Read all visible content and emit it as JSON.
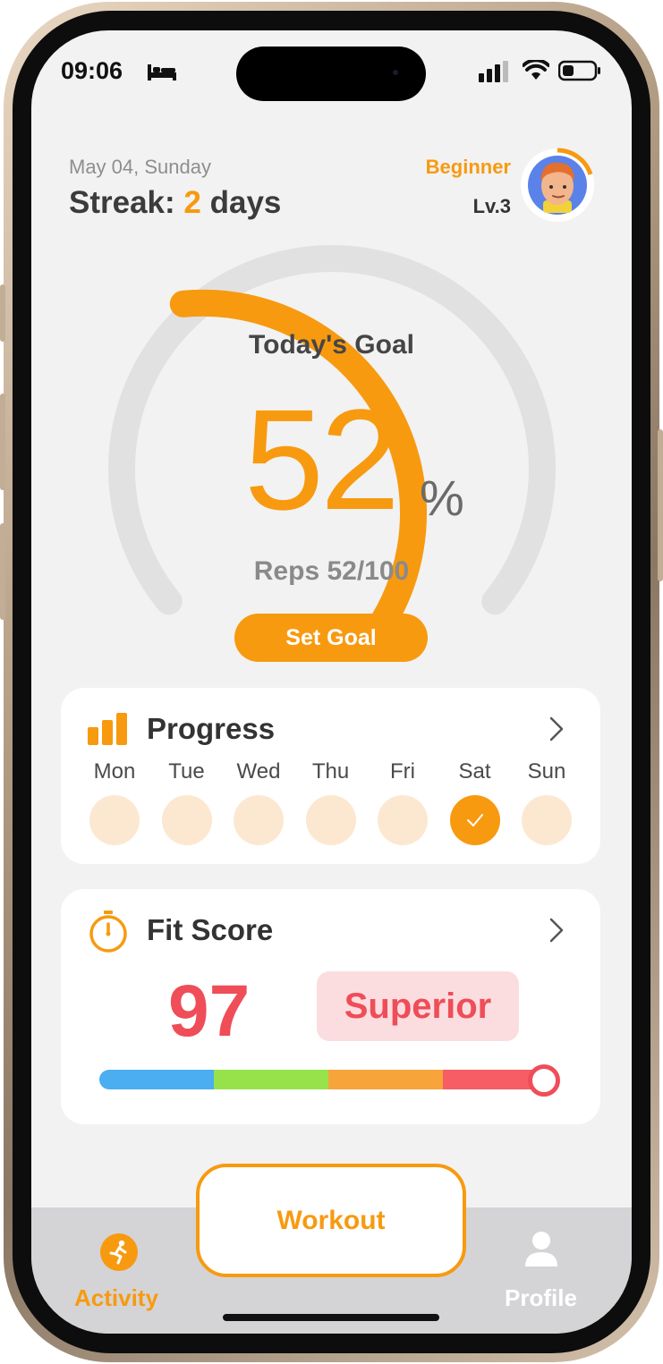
{
  "status_bar": {
    "time": "09:06"
  },
  "header": {
    "date": "May 04, Sunday",
    "streak_prefix": "Streak: ",
    "streak_count": "2",
    "streak_suffix": " days",
    "level_name": "Beginner",
    "level_number": "Lv.3"
  },
  "goal": {
    "label": "Today's Goal",
    "value": "52",
    "unit": "%",
    "progress_fraction": 0.52,
    "reps_text": "Reps 52/100",
    "set_goal_label": "Set Goal"
  },
  "progress_card": {
    "title": "Progress",
    "days": [
      {
        "label": "Mon",
        "done": false
      },
      {
        "label": "Tue",
        "done": false
      },
      {
        "label": "Wed",
        "done": false
      },
      {
        "label": "Thu",
        "done": false
      },
      {
        "label": "Fri",
        "done": false
      },
      {
        "label": "Sat",
        "done": true
      },
      {
        "label": "Sun",
        "done": false
      }
    ]
  },
  "fit_card": {
    "title": "Fit Score",
    "score": "97",
    "rating": "Superior",
    "score_fraction": 0.97
  },
  "tabbar": {
    "activity_label": "Activity",
    "workout_label": "Workout",
    "profile_label": "Profile"
  },
  "colors": {
    "accent": "#f79a10",
    "score_red": "#ef4d58",
    "scale": [
      "#4aaef0",
      "#97e24a",
      "#f7a43a",
      "#f65d65"
    ]
  },
  "icons": [
    "bed-icon",
    "signal-icon",
    "wifi-icon",
    "battery-icon",
    "bar-chart-icon",
    "chevron-right-icon",
    "stopwatch-icon",
    "running-person-icon",
    "person-icon",
    "checkmark-icon"
  ]
}
